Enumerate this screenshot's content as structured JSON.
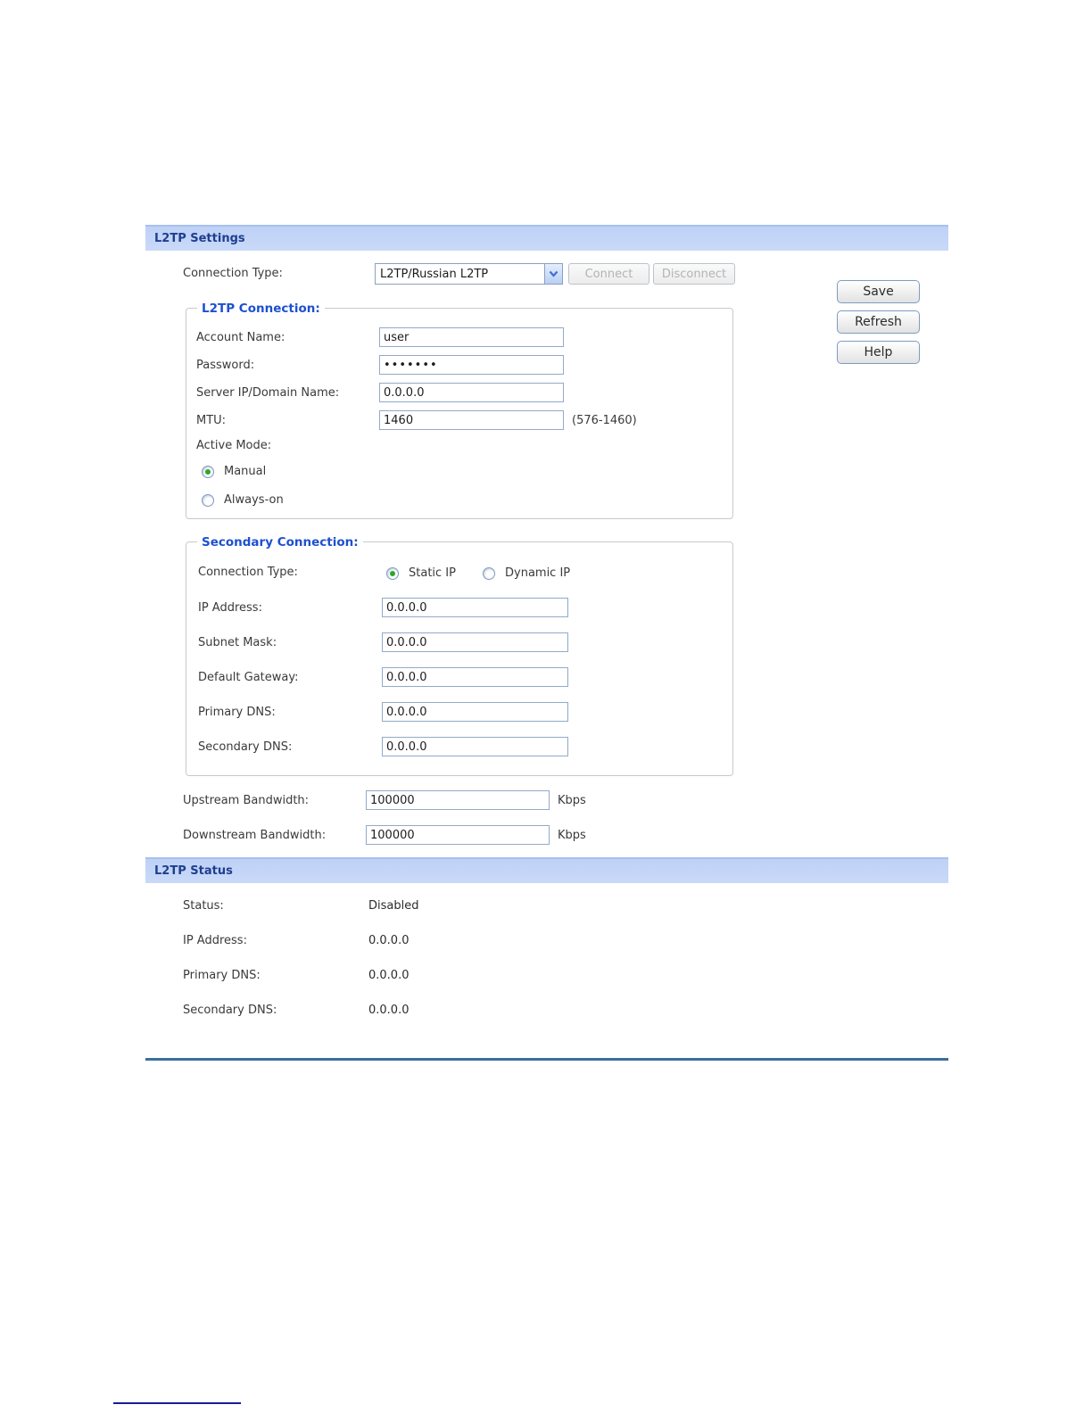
{
  "headers": {
    "settings_title": "L2TP Settings",
    "status_title": "L2TP Status"
  },
  "toolbar": {
    "save": "Save",
    "refresh": "Refresh",
    "help": "Help"
  },
  "connection_row": {
    "label": "Connection Type:",
    "selected_option": "L2TP/Russian L2TP",
    "connect": "Connect",
    "disconnect": "Disconnect"
  },
  "l2tp": {
    "legend": "L2TP Connection:",
    "account": {
      "label": "Account Name:",
      "value": "user"
    },
    "password": {
      "label": "Password:",
      "value": "•••••••"
    },
    "server": {
      "label": "Server IP/Domain Name:",
      "value": "0.0.0.0"
    },
    "mtu": {
      "label": "MTU:",
      "value": "1460",
      "range_note": "(576-1460)"
    },
    "active_mode": {
      "label": "Active Mode:",
      "manual": "Manual",
      "always_on": "Always-on",
      "selected": "Manual"
    }
  },
  "secondary": {
    "legend": "Secondary Connection:",
    "type": {
      "label": "Connection Type:",
      "static_ip": "Static IP",
      "dynamic_ip": "Dynamic IP",
      "selected": "Static IP"
    },
    "ip": {
      "label": "IP Address:",
      "value": "0.0.0.0"
    },
    "mask": {
      "label": "Subnet Mask:",
      "value": "0.0.0.0"
    },
    "gateway": {
      "label": "Default Gateway:",
      "value": "0.0.0.0"
    },
    "dns1": {
      "label": "Primary DNS:",
      "value": "0.0.0.0"
    },
    "dns2": {
      "label": "Secondary DNS:",
      "value": "0.0.0.0"
    }
  },
  "bandwidth": {
    "up": {
      "label": "Upstream Bandwidth:",
      "value": "100000",
      "unit": "Kbps"
    },
    "down": {
      "label": "Downstream Bandwidth:",
      "value": "100000",
      "unit": "Kbps"
    }
  },
  "status": {
    "rows": [
      {
        "label": "Status:",
        "value": "Disabled"
      },
      {
        "label": "IP Address:",
        "value": "0.0.0.0"
      },
      {
        "label": "Primary DNS:",
        "value": "0.0.0.0"
      },
      {
        "label": "Secondary DNS:",
        "value": "0.0.0.0"
      }
    ]
  },
  "colors": {
    "header_bg": "#c4d6f7",
    "header_text": "#1e3f8f",
    "legend_text": "#1d50cf",
    "divider": "#3a6f9e",
    "radio_selected_dot": "#2ea52e",
    "footer_line": "#1b1b96"
  }
}
